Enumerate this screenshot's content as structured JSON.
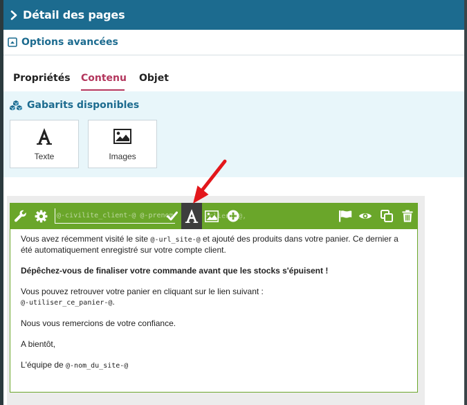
{
  "header": {
    "title": "Détail des pages"
  },
  "options": {
    "title": "Options avancées"
  },
  "tabs": [
    {
      "label": "Propriétés",
      "active": false
    },
    {
      "label": "Contenu",
      "active": true
    },
    {
      "label": "Objet",
      "active": false
    }
  ],
  "gabarits": {
    "title": "Gabarits disponibles",
    "cards": [
      {
        "label": "Texte",
        "icon": "text-A-icon"
      },
      {
        "label": "Images",
        "icon": "image-icon"
      }
    ]
  },
  "toolbar": {
    "name_input_value": "@-civilite_client-@ @-prenom_client-@ @-nom_client-@",
    "ghost_text": "-client-@,",
    "icons_left": [
      "wrench-icon",
      "gear-icon",
      "check-icon"
    ],
    "icons_middle": [
      "text-A-icon",
      "image-icon",
      "plus-circle-icon"
    ],
    "icons_right": [
      "flag-icon",
      "eye-icon",
      "copy-icon",
      "trash-icon"
    ]
  },
  "content": {
    "p1_a": "Vous avez récemment visité le site ",
    "p1_code": "@-url_site-@",
    "p1_b": " et ajouté des produits dans votre panier. Ce dernier a été automatiquement enregistré sur votre compte client.",
    "p2": "Dépêchez-vous de finaliser votre commande avant que les stocks s'épuisent !",
    "p3_a": "Vous pouvez retrouver votre panier en cliquant sur le lien suivant :",
    "p3_code": "@-utiliser_ce_panier-@",
    "p3_b": ".",
    "p4": "Nous vous remercions de votre confiance.",
    "p5": "A bientôt,",
    "p6_a": "L'équipe de ",
    "p6_code": "@-nom_du_site-@"
  },
  "colors": {
    "header_bg": "#1c6b8f",
    "accent_tab": "#b3365d",
    "toolbar_green": "#6aa62a",
    "gabarits_bg": "#e8f6fa",
    "arrow_red": "#e3171b"
  }
}
